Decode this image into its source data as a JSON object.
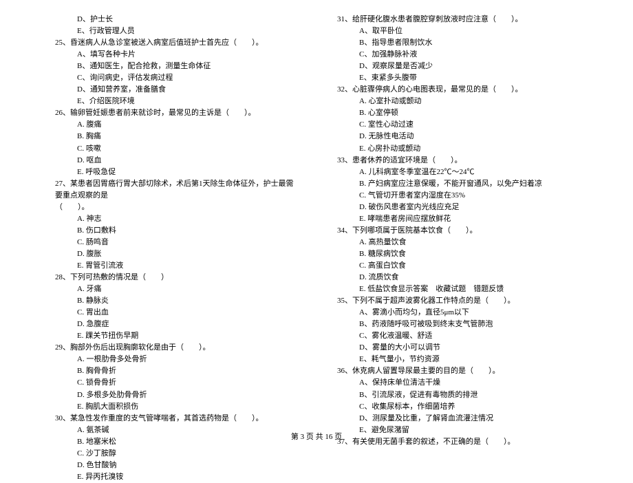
{
  "left_column": [
    {
      "cls": "option",
      "text": "D、护士长"
    },
    {
      "cls": "option",
      "text": "E、行政管理人员"
    },
    {
      "cls": "question",
      "text": "25、昏迷病人从急诊室被送入病室后值班护士首先应（　　）。"
    },
    {
      "cls": "option",
      "text": "A、填写各种卡片"
    },
    {
      "cls": "option",
      "text": "B、通知医生，配合抢救，测量生命体征"
    },
    {
      "cls": "option",
      "text": "C、询问病史，评估发病过程"
    },
    {
      "cls": "option",
      "text": "D、通知营养室，准备膳食"
    },
    {
      "cls": "option",
      "text": "E、介绍医院环境"
    },
    {
      "cls": "question",
      "text": "26、输卵管妊娠患者前来就诊时，最常见的主诉是（　　）。"
    },
    {
      "cls": "option",
      "text": "A. 腹痛"
    },
    {
      "cls": "option",
      "text": "B. 胸痛"
    },
    {
      "cls": "option",
      "text": "C. 咳嗽"
    },
    {
      "cls": "option",
      "text": "D. 呕血"
    },
    {
      "cls": "option",
      "text": "E. 呼吸急促"
    },
    {
      "cls": "question",
      "text": "27、某患者因胃癌行胃大部切除术，术后第1天除生命体征外，护士最需要重点观察的是"
    },
    {
      "cls": "question",
      "text": "（　　）。"
    },
    {
      "cls": "option",
      "text": "A. 神志"
    },
    {
      "cls": "option",
      "text": "B. 伤口敷料"
    },
    {
      "cls": "option",
      "text": "C. 肠鸣音"
    },
    {
      "cls": "option",
      "text": "D. 腹胀"
    },
    {
      "cls": "option",
      "text": "E. 胃管引流液"
    },
    {
      "cls": "question",
      "text": "28、下列可热敷的情况是（　　）"
    },
    {
      "cls": "option",
      "text": "A. 牙痛"
    },
    {
      "cls": "option",
      "text": "B. 静脉炎"
    },
    {
      "cls": "option",
      "text": "C. 胃出血"
    },
    {
      "cls": "option",
      "text": "D. 急腹症"
    },
    {
      "cls": "option",
      "text": "E. 踝关节扭伤早期"
    },
    {
      "cls": "question",
      "text": "29、胸部外伤后出现胸廓软化是由于（　　）。"
    },
    {
      "cls": "option",
      "text": "A. 一根肋骨多处骨折"
    },
    {
      "cls": "option",
      "text": "B. 胸骨骨折"
    },
    {
      "cls": "option",
      "text": "C. 锁骨骨折"
    },
    {
      "cls": "option",
      "text": "D. 多根多处肋骨骨折"
    },
    {
      "cls": "option",
      "text": "E. 胸肌大面积损伤"
    },
    {
      "cls": "question",
      "text": "30、某急性发作重度的支气管哮喘者，其首选药物是（　　）。"
    },
    {
      "cls": "option",
      "text": "A. 氨茶碱"
    },
    {
      "cls": "option",
      "text": "B. 地塞米松"
    },
    {
      "cls": "option",
      "text": "C. 沙丁胺醇"
    },
    {
      "cls": "option",
      "text": "D. 色甘酸钠"
    },
    {
      "cls": "option",
      "text": "E. 异丙托溴铵"
    }
  ],
  "right_column": [
    {
      "cls": "question",
      "text": "31、给肝硬化腹水患者腹腔穿刺放液时应注意（　　）。"
    },
    {
      "cls": "option",
      "text": "A、取平卧位"
    },
    {
      "cls": "option",
      "text": "B、指导患者限制饮水"
    },
    {
      "cls": "option",
      "text": "C、加强静脉补液"
    },
    {
      "cls": "option",
      "text": "D、观察尿量是否减少"
    },
    {
      "cls": "option",
      "text": "E、束紧多头腹带"
    },
    {
      "cls": "question",
      "text": "32、心脏骤停病人的心电图表现，最常见的是（　　）。"
    },
    {
      "cls": "option",
      "text": "A. 心室扑动或颤动"
    },
    {
      "cls": "option",
      "text": "B. 心室停顿"
    },
    {
      "cls": "option",
      "text": "C. 室性心动过速"
    },
    {
      "cls": "option",
      "text": "D. 无脉性电活动"
    },
    {
      "cls": "option",
      "text": "E. 心房扑动或颤动"
    },
    {
      "cls": "question",
      "text": "33、患者休养的适宜环境是（　　）。"
    },
    {
      "cls": "option",
      "text": "A. 儿科病室冬季室温在22℃～24℃"
    },
    {
      "cls": "option",
      "text": "B. 产妇病室应注意保暖，不能开窗通风，以免产妇着凉"
    },
    {
      "cls": "option",
      "text": "C. 气管切开患者室内湿度在35%"
    },
    {
      "cls": "option",
      "text": "D. 破伤风患者室内光线应充足"
    },
    {
      "cls": "option",
      "text": "E. 哮喘患者房间应摆放鲜花"
    },
    {
      "cls": "question",
      "text": "34、下列哪项属于医院基本饮食（　　）。"
    },
    {
      "cls": "option",
      "text": "A. 高热量饮食"
    },
    {
      "cls": "option",
      "text": "B. 糖尿病饮食"
    },
    {
      "cls": "option",
      "text": "C. 高蛋白饮食"
    },
    {
      "cls": "option",
      "text": "D. 流质饮食"
    },
    {
      "cls": "option",
      "text": "E. 低盐饮食显示答案　收藏试题　错题反馈"
    },
    {
      "cls": "question",
      "text": "35、下列不属于超声波雾化器工作特点的是（　　）。"
    },
    {
      "cls": "option",
      "text": "A、雾滴小而均匀，直径5μm以下"
    },
    {
      "cls": "option",
      "text": "B、药液随呼吸可被吸到终末支气管肺泡"
    },
    {
      "cls": "option",
      "text": "C、雾化液温暖、舒适"
    },
    {
      "cls": "option",
      "text": "D、雾量的大小可以调节"
    },
    {
      "cls": "option",
      "text": "E、耗气量小，节约资源"
    },
    {
      "cls": "question",
      "text": "36、休克病人留置导尿最主要的目的是（　　）。"
    },
    {
      "cls": "option",
      "text": "A、保持床单位清洁干燥"
    },
    {
      "cls": "option",
      "text": "B、引流尿液，促进有毒物质的排泄"
    },
    {
      "cls": "option",
      "text": "C、收集尿标本，作细菌培养"
    },
    {
      "cls": "option",
      "text": "D、测尿量及比重，了解肾血流灌注情况"
    },
    {
      "cls": "option",
      "text": "E、避免尿潴留"
    },
    {
      "cls": "question",
      "text": "37、有关使用无菌手套的叙述，不正确的是（　　）。"
    }
  ],
  "footer": "第 3 页 共 16 页"
}
